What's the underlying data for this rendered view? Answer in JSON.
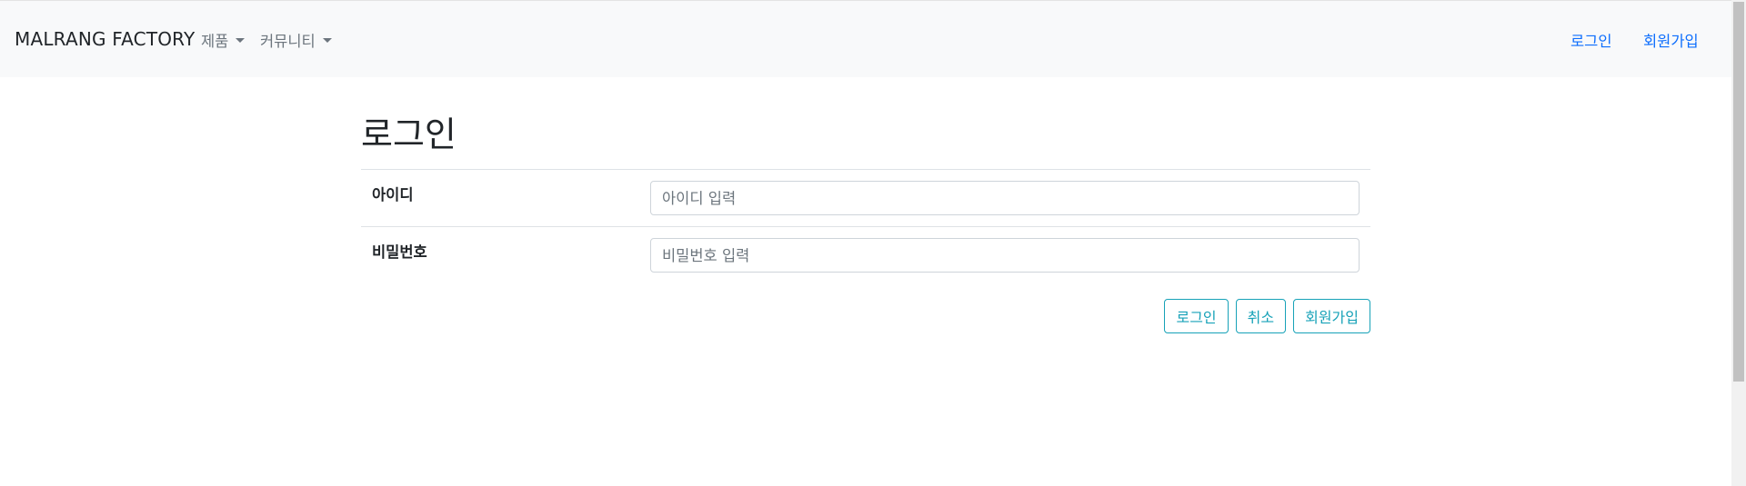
{
  "navbar": {
    "brand": "MALRANG FACTORY",
    "menus": [
      {
        "label": "제품"
      },
      {
        "label": "커뮤니티"
      }
    ],
    "right_links": [
      {
        "label": "로그인"
      },
      {
        "label": "회원가입"
      }
    ]
  },
  "main": {
    "title": "로그인",
    "fields": [
      {
        "label": "아이디",
        "placeholder": "아이디 입력",
        "value": ""
      },
      {
        "label": "비밀번호",
        "placeholder": "비밀번호 입력",
        "value": ""
      }
    ],
    "buttons": {
      "login": "로그인",
      "cancel": "취소",
      "signup": "회원가입"
    }
  },
  "colors": {
    "navbar_bg": "#f8f9fa",
    "link": "#0d6efd",
    "button_outline": "#17a2b8",
    "muted_nav": "#6c757d"
  },
  "icons": [
    "caret-down-icon"
  ]
}
